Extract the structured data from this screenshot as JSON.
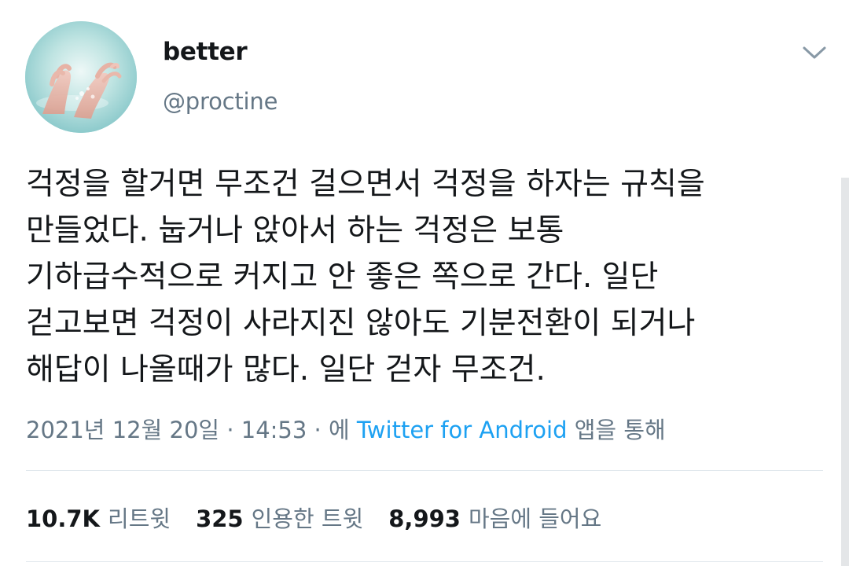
{
  "author": {
    "display_name": "better",
    "handle": "@proctine",
    "avatar_icon": "hands-in-water-avatar"
  },
  "tweet": {
    "lines": [
      "걱정을 할거면 무조건 걸으면서 걱정을 하자는 규칙을",
      "만들었다. 눕거나 앉아서 하는 걱정은 보통",
      "기하급수적으로 커지고 안 좋은 쪽으로 간다. 일단",
      "걷고보면 걱정이 사라지진 않아도 기분전환이 되거나",
      "해답이 나올때가 많다. 일단 걷자 무조건."
    ]
  },
  "meta": {
    "date": "2021년 12월 20일",
    "separator": "·",
    "time": "14:53",
    "source_prefix": "에",
    "source": "Twitter for Android",
    "source_suffix": "앱을 통해"
  },
  "stats": {
    "retweets_count": "10.7K",
    "retweets_label": "리트윗",
    "quotes_count": "325",
    "quotes_label": "인용한 트윗",
    "likes_count": "8,993",
    "likes_label": "마음에 들어요"
  },
  "colors": {
    "text_primary": "#14171a",
    "text_secondary": "#657786",
    "link": "#1da1f2",
    "divider": "#e1e8ed"
  }
}
